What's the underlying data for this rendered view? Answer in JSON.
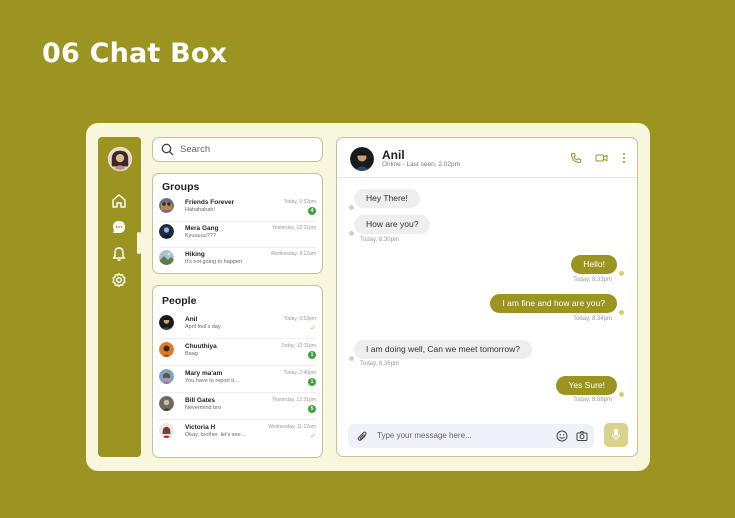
{
  "page": {
    "title": "06 Chat Box"
  },
  "sidebar": {
    "items": [
      {
        "icon": "home-icon"
      },
      {
        "icon": "chat-icon",
        "active": true
      },
      {
        "icon": "bell-icon"
      },
      {
        "icon": "gear-icon"
      }
    ]
  },
  "search": {
    "placeholder": "Search"
  },
  "groups": {
    "title": "Groups",
    "items": [
      {
        "name": "Friends Forever",
        "preview": "Hahahahah!",
        "time": "Today, 9:52pm",
        "unread": "4"
      },
      {
        "name": "Mera Gang",
        "preview": "Kyuuuuu???",
        "time": "Yesterday, 12:31pm",
        "unread": ""
      },
      {
        "name": "Hiking",
        "preview": "It's not going to happen",
        "time": "Wednesday, 9:12am",
        "unread": ""
      }
    ]
  },
  "people": {
    "title": "People",
    "items": [
      {
        "name": "Anil",
        "preview": "April fool's day",
        "time": "Today, 9:52pm",
        "unread": "",
        "read": true
      },
      {
        "name": "Chuuthiya",
        "preview": "Baag",
        "time": "Today, 12:11pm",
        "unread": "1",
        "read": false
      },
      {
        "name": "Mary ma'am",
        "preview": "You have to report it...",
        "time": "Today, 2:40pm",
        "unread": "1",
        "read": false
      },
      {
        "name": "Bill Gates",
        "preview": "Nevermind bro",
        "time": "Yesterday, 12:31pm",
        "unread": "5",
        "read": false
      },
      {
        "name": "Victoria H",
        "preview": "Okay, brother. let's see...",
        "time": "Wednesday, 11:12am",
        "unread": "",
        "read": true
      }
    ]
  },
  "chat": {
    "contact": {
      "name": "Anil",
      "status": "Online - Last seen, 2.02pm"
    },
    "messages": [
      {
        "text": "Hey There!",
        "time": "",
        "direction": "in"
      },
      {
        "text": "How are you?",
        "time": "Today, 8.30pm",
        "direction": "in"
      },
      {
        "text": "Hello!",
        "time": "Today, 8.33pm",
        "direction": "out"
      },
      {
        "text": "I am fine and how are you?",
        "time": "Today, 8.34pm",
        "direction": "out"
      },
      {
        "text": "I am doing well, Can we meet tomorrow?",
        "time": "Today, 8.36pm",
        "direction": "in"
      },
      {
        "text": "Yes Sure!",
        "time": "Today, 8.58pm",
        "direction": "out"
      }
    ],
    "input": {
      "placeholder": "Type your message here..."
    }
  },
  "colors": {
    "brand": "#9c9421",
    "background": "#f8f6dc",
    "unread": "#3fa33a"
  }
}
